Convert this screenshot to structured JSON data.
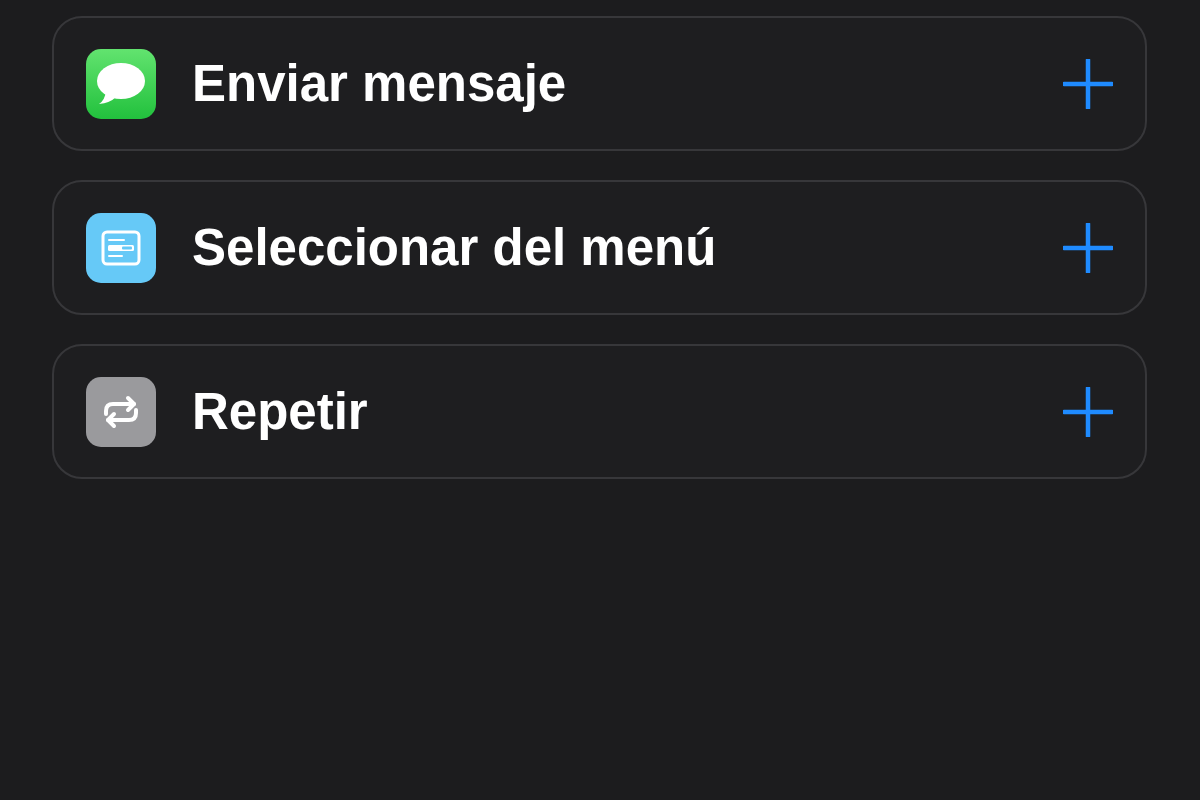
{
  "actions": [
    {
      "kind": "messages",
      "label": "Enviar mensaje"
    },
    {
      "kind": "menu",
      "label": "Seleccionar del menú"
    },
    {
      "kind": "repeat",
      "label": "Repetir"
    }
  ]
}
